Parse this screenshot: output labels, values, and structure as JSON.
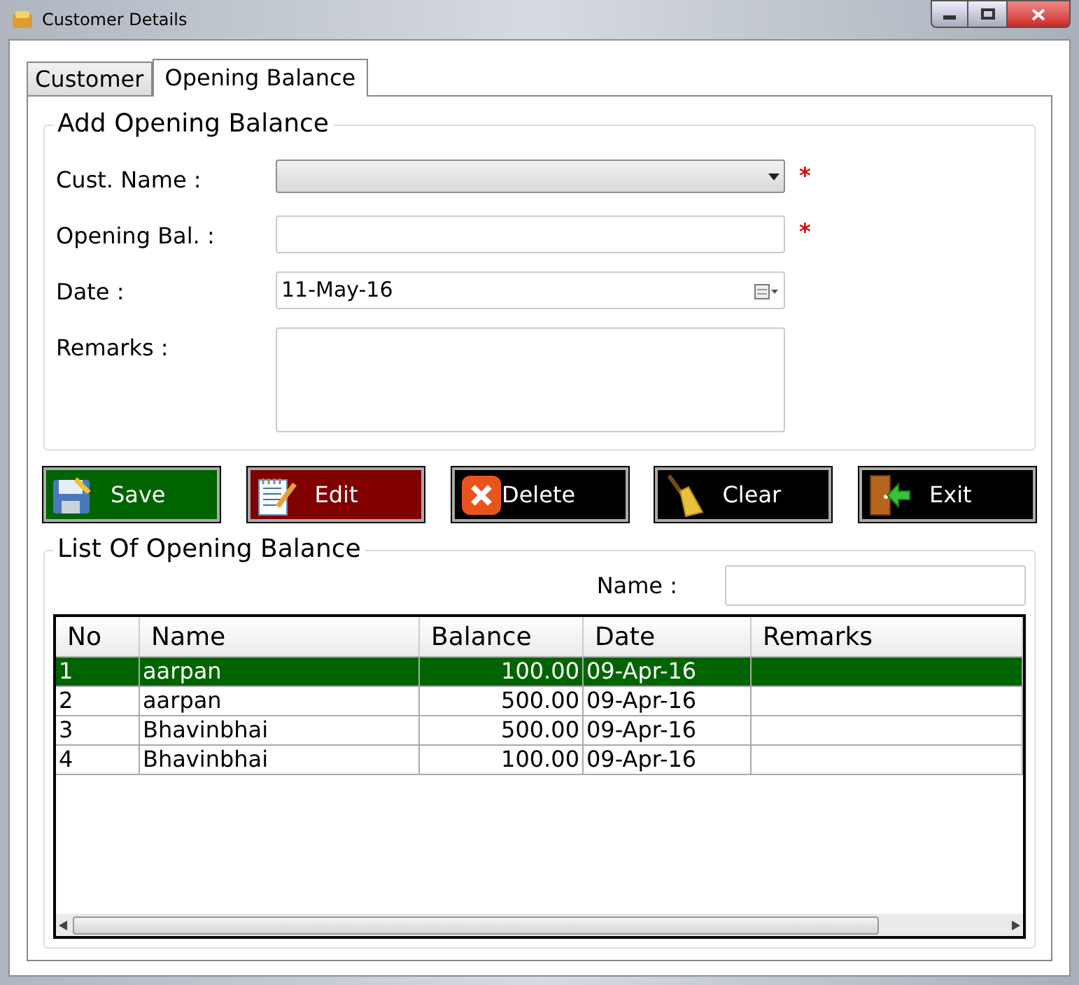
{
  "window": {
    "title": "Customer Details"
  },
  "tabs": [
    {
      "label": "Customer",
      "selected": false
    },
    {
      "label": "Opening Balance",
      "selected": true
    }
  ],
  "form": {
    "title": "Add Opening Balance",
    "fields": [
      {
        "kind": "dropdown",
        "label": "Cust. Name :",
        "required": true
      },
      {
        "kind": "text",
        "label": "Opening Bal. :",
        "required": true
      },
      {
        "kind": "date",
        "label": "Date :",
        "value": "11-May-16",
        "required": false
      },
      {
        "kind": "textarea",
        "label": "Remarks :",
        "required": false
      }
    ],
    "required_mark": "*"
  },
  "buttons": [
    {
      "kind": "save",
      "label": "Save",
      "color": "#006400"
    },
    {
      "kind": "edit",
      "label": "Edit",
      "color": "#800000"
    },
    {
      "kind": "delete",
      "label": "Delete",
      "color": "#000000"
    },
    {
      "kind": "clear",
      "label": "Clear",
      "color": "#000000"
    },
    {
      "kind": "exit",
      "label": "Exit",
      "color": "#000000"
    }
  ],
  "list": {
    "title": "List Of Opening Balance",
    "filter_label": "Name :",
    "columns": [
      "No",
      "Name",
      "Balance",
      "Date",
      "Remarks"
    ],
    "rows": [
      {
        "cells": [
          "1",
          "aarpan",
          "100.00",
          "09-Apr-16",
          ""
        ],
        "selected": true
      },
      {
        "cells": [
          "2",
          "aarpan",
          "500.00",
          "09-Apr-16",
          ""
        ],
        "selected": false
      },
      {
        "cells": [
          "3",
          "Bhavinbhai",
          "500.00",
          "09-Apr-16",
          ""
        ],
        "selected": false
      },
      {
        "cells": [
          "4",
          "Bhavinbhai",
          "100.00",
          "09-Apr-16",
          ""
        ],
        "selected": false
      }
    ]
  }
}
